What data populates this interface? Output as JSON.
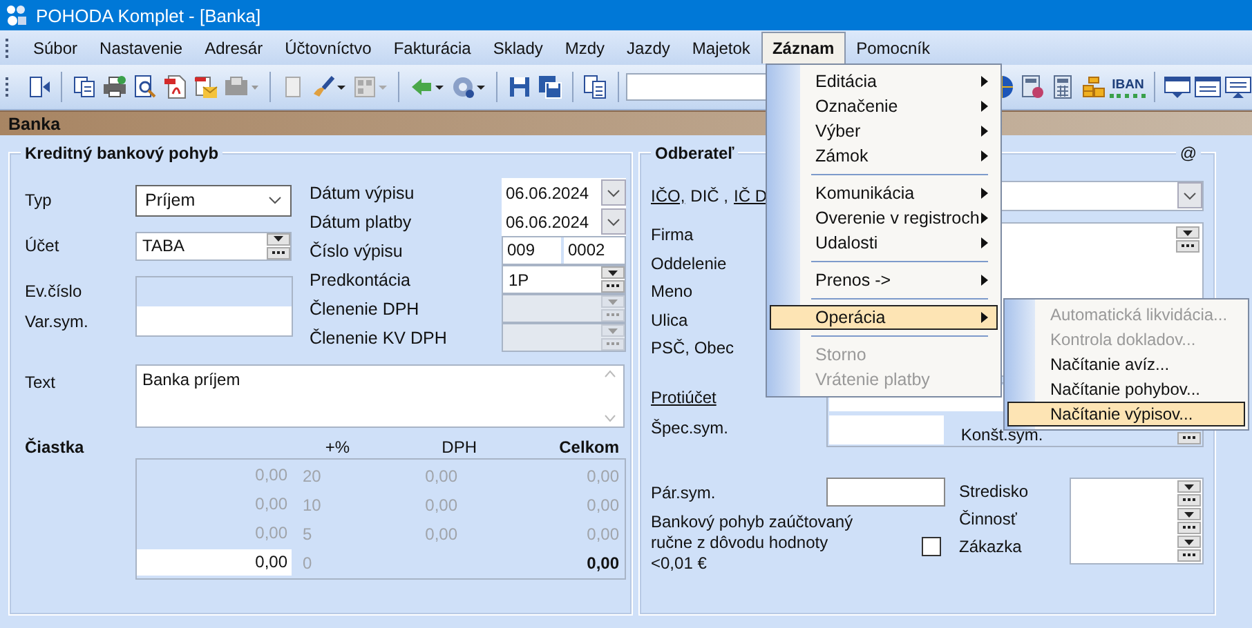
{
  "window": {
    "title": "POHODA Komplet - [Banka]"
  },
  "menu_bar": [
    {
      "label": "Súbor",
      "selected": false
    },
    {
      "label": "Nastavenie",
      "selected": false
    },
    {
      "label": "Adresár",
      "selected": false
    },
    {
      "label": "Účtovníctvo",
      "selected": false
    },
    {
      "label": "Fakturácia",
      "selected": false
    },
    {
      "label": "Sklady",
      "selected": false
    },
    {
      "label": "Mzdy",
      "selected": false
    },
    {
      "label": "Jazdy",
      "selected": false
    },
    {
      "label": "Majetok",
      "selected": false
    },
    {
      "label": "Záznam",
      "selected": true
    },
    {
      "label": "Pomocník",
      "selected": false
    }
  ],
  "toolbar": {
    "iban_label": "IBAN"
  },
  "section_title": "Banka",
  "credit_movement": {
    "title": "Kreditný bankový pohyb",
    "type": {
      "label": "Typ",
      "value": "Príjem"
    },
    "account": {
      "label": "Účet",
      "value": "TABA"
    },
    "ev_number": {
      "label": "Ev.číslo",
      "disabled": true
    },
    "var_symbol": {
      "label": "Var.sym."
    },
    "statement_date": {
      "label": "Dátum výpisu",
      "value": "06.06.2024"
    },
    "payment_date": {
      "label": "Dátum platby",
      "value": "06.06.2024"
    },
    "statement_number": {
      "label": "Číslo výpisu",
      "value": "009",
      "value_2": "0002"
    },
    "precontation": {
      "label": "Predkontácia",
      "value": "1P",
      "disabled": false
    },
    "vat_split": {
      "label": "Členenie DPH",
      "disabled": true
    },
    "kv_vat_split": {
      "label": "Členenie KV DPH",
      "disabled": true
    },
    "text": {
      "label": "Text",
      "value": "Banka príjem"
    },
    "amounts": {
      "label": "Čiastka",
      "columns": [
        "+%",
        "DPH",
        "Celkom"
      ],
      "rows": [
        {
          "amount": "0,00",
          "rate": "20",
          "vat": "0,00",
          "total": "0,00",
          "editable": false
        },
        {
          "amount": "0,00",
          "rate": "10",
          "vat": "0,00",
          "total": "0,00",
          "editable": false
        },
        {
          "amount": "0,00",
          "rate": "5",
          "vat": "0,00",
          "total": "0,00",
          "editable": false
        },
        {
          "amount": "0,00",
          "rate": "0",
          "total": "0,00",
          "editable": true
        }
      ]
    }
  },
  "customer": {
    "title": "Odberateľ",
    "email_mark": "@",
    "id_links": [
      {
        "label": "IČO,",
        "kind": "link"
      },
      {
        "label": "DIČ ,",
        "kind": "text"
      },
      {
        "label": "IČ D",
        "kind": "link"
      }
    ],
    "address_labels": [
      "Firma",
      "Oddelenie",
      "Meno",
      "Ulica",
      "PSČ, Obec"
    ],
    "counter_account": {
      "label": "Protiúčet"
    },
    "spec_symbol": {
      "label": "Špec.sym."
    },
    "const_symbol": {
      "label": "Konšt.sym."
    },
    "pair_symbol": {
      "label": "Pár.sym."
    },
    "manual_posting": {
      "label": "Bankový pohyb zaúčtovaný ručne z dôvodu hodnoty <0,01 €",
      "checked": false
    },
    "cost_labels": [
      "Stredisko",
      "Činnosť",
      "Zákazka"
    ]
  },
  "menu": {
    "items": [
      {
        "kind": "submenu",
        "label": "Editácia",
        "disabled": false,
        "selected": false
      },
      {
        "kind": "submenu",
        "label": "Označenie",
        "disabled": false,
        "selected": false
      },
      {
        "kind": "submenu",
        "label": "Výber",
        "disabled": false,
        "selected": false
      },
      {
        "kind": "submenu",
        "label": "Zámok",
        "disabled": false,
        "selected": false
      },
      {
        "kind": "separator"
      },
      {
        "kind": "submenu",
        "label": "Komunikácia",
        "disabled": false,
        "selected": false
      },
      {
        "kind": "submenu",
        "label": "Overenie v registroch",
        "disabled": false,
        "selected": false
      },
      {
        "kind": "submenu",
        "label": "Udalosti",
        "disabled": false,
        "selected": false
      },
      {
        "kind": "separator"
      },
      {
        "kind": "submenu",
        "label": "Prenos ->",
        "disabled": false,
        "selected": false
      },
      {
        "kind": "separator"
      },
      {
        "kind": "submenu",
        "label": "Operácia",
        "disabled": false,
        "selected": true
      },
      {
        "kind": "separator"
      },
      {
        "kind": "command",
        "label": "Storno",
        "disabled": true,
        "selected": false
      },
      {
        "kind": "command",
        "label": "Vrátenie platby",
        "disabled": true,
        "selected": false
      }
    ],
    "submenu": [
      {
        "label": "Automatická likvidácia...",
        "disabled": true,
        "selected": false
      },
      {
        "label": "Kontrola dokladov...",
        "disabled": true,
        "selected": false
      },
      {
        "label": "Načítanie avíz...",
        "disabled": false,
        "selected": false
      },
      {
        "label": "Načítanie pohybov...",
        "disabled": false,
        "selected": false
      },
      {
        "label": "Načítanie výpisov...",
        "disabled": false,
        "selected": true
      }
    ]
  }
}
